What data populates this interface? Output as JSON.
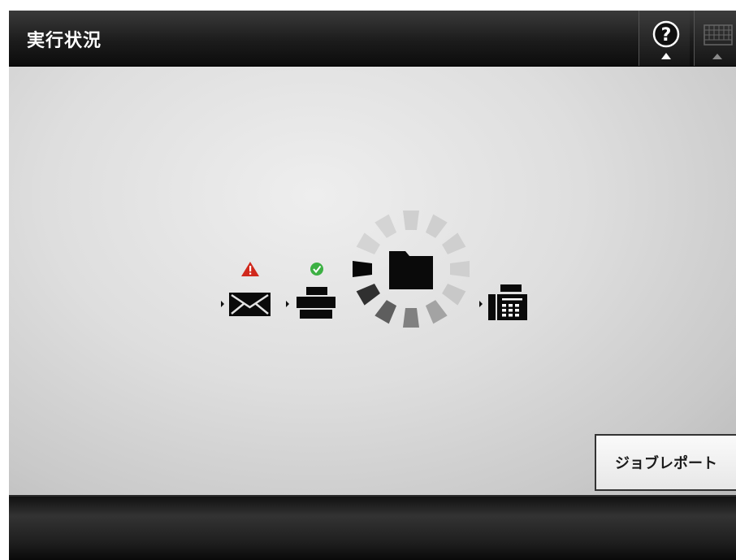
{
  "header": {
    "title": "実行状況",
    "help_icon": "help-question-icon",
    "keyboard_icon": "keyboard-icon"
  },
  "destinations": [
    {
      "icon": "email-icon",
      "status": "warning"
    },
    {
      "icon": "printer-icon",
      "status": "success"
    },
    {
      "icon": "folder-icon",
      "status": "in-progress"
    },
    {
      "icon": "fax-icon",
      "status": "pending"
    }
  ],
  "job_report_button": {
    "label": "ジョブレポート"
  },
  "colors": {
    "header_bg": "#1c1c1c",
    "warning": "#d0281c",
    "success": "#3cb043"
  }
}
